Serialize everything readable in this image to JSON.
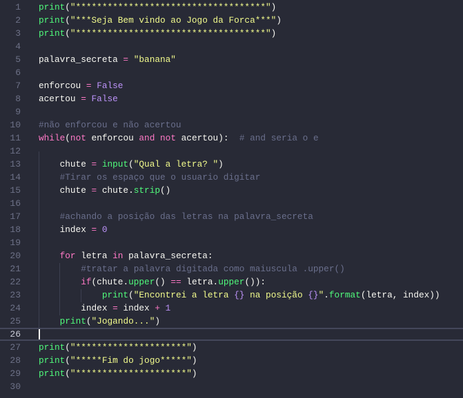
{
  "theme": {
    "background": "#282a36",
    "function": "#50fa7b",
    "string": "#f1fa8c",
    "keyword": "#ff79c6",
    "constant": "#bd93f9",
    "comment": "#6a6f8c"
  },
  "editor": {
    "current_line": 26,
    "lines": [
      {
        "n": "1",
        "tokens": [
          [
            "fn",
            "print"
          ],
          [
            "id",
            "("
          ],
          [
            "str",
            "\"************************************\""
          ],
          [
            "id",
            ")"
          ]
        ]
      },
      {
        "n": "2",
        "tokens": [
          [
            "fn",
            "print"
          ],
          [
            "id",
            "("
          ],
          [
            "str",
            "\"***Seja Bem vindo ao Jogo da Forca***\""
          ],
          [
            "id",
            ")"
          ]
        ]
      },
      {
        "n": "3",
        "tokens": [
          [
            "fn",
            "print"
          ],
          [
            "id",
            "("
          ],
          [
            "str",
            "\"************************************\""
          ],
          [
            "id",
            ")"
          ]
        ]
      },
      {
        "n": "4",
        "tokens": []
      },
      {
        "n": "5",
        "tokens": [
          [
            "id",
            "palavra_secreta "
          ],
          [
            "op",
            "="
          ],
          [
            "id",
            " "
          ],
          [
            "str",
            "\"banana\""
          ]
        ]
      },
      {
        "n": "6",
        "tokens": []
      },
      {
        "n": "7",
        "tokens": [
          [
            "id",
            "enforcou "
          ],
          [
            "op",
            "="
          ],
          [
            "id",
            " "
          ],
          [
            "const",
            "False"
          ]
        ]
      },
      {
        "n": "8",
        "tokens": [
          [
            "id",
            "acertou "
          ],
          [
            "op",
            "="
          ],
          [
            "id",
            " "
          ],
          [
            "const",
            "False"
          ]
        ]
      },
      {
        "n": "9",
        "tokens": []
      },
      {
        "n": "10",
        "tokens": [
          [
            "cm",
            "#não enforcou e não acertou"
          ]
        ]
      },
      {
        "n": "11",
        "tokens": [
          [
            "kw",
            "while"
          ],
          [
            "id",
            "("
          ],
          [
            "kw",
            "not"
          ],
          [
            "id",
            " enforcou "
          ],
          [
            "kw",
            "and"
          ],
          [
            "id",
            " "
          ],
          [
            "kw",
            "not"
          ],
          [
            "id",
            " acertou):  "
          ],
          [
            "cm",
            "# and seria o e"
          ]
        ]
      },
      {
        "n": "12",
        "tokens": []
      },
      {
        "n": "13",
        "tokens": [
          [
            "id",
            "    chute "
          ],
          [
            "op",
            "="
          ],
          [
            "id",
            " "
          ],
          [
            "fn",
            "input"
          ],
          [
            "id",
            "("
          ],
          [
            "str",
            "\"Qual a letra? \""
          ],
          [
            "id",
            ")"
          ]
        ]
      },
      {
        "n": "14",
        "tokens": [
          [
            "id",
            "    "
          ],
          [
            "cm",
            "#Tirar os espaço que o usuario digitar"
          ]
        ]
      },
      {
        "n": "15",
        "tokens": [
          [
            "id",
            "    chute "
          ],
          [
            "op",
            "="
          ],
          [
            "id",
            " chute."
          ],
          [
            "fn",
            "strip"
          ],
          [
            "id",
            "()"
          ]
        ]
      },
      {
        "n": "16",
        "tokens": []
      },
      {
        "n": "17",
        "tokens": [
          [
            "id",
            "    "
          ],
          [
            "cm",
            "#achando a posição das letras na palavra_secreta"
          ]
        ]
      },
      {
        "n": "18",
        "tokens": [
          [
            "id",
            "    index "
          ],
          [
            "op",
            "="
          ],
          [
            "id",
            " "
          ],
          [
            "num",
            "0"
          ]
        ]
      },
      {
        "n": "19",
        "tokens": []
      },
      {
        "n": "20",
        "tokens": [
          [
            "id",
            "    "
          ],
          [
            "kw",
            "for"
          ],
          [
            "id",
            " letra "
          ],
          [
            "kw",
            "in"
          ],
          [
            "id",
            " palavra_secreta:"
          ]
        ]
      },
      {
        "n": "21",
        "tokens": [
          [
            "id",
            "        "
          ],
          [
            "cm",
            "#tratar a palavra digitada como maiuscula .upper()"
          ]
        ]
      },
      {
        "n": "22",
        "tokens": [
          [
            "id",
            "        "
          ],
          [
            "kw",
            "if"
          ],
          [
            "id",
            "(chute."
          ],
          [
            "fn",
            "upper"
          ],
          [
            "id",
            "() "
          ],
          [
            "op",
            "=="
          ],
          [
            "id",
            " letra."
          ],
          [
            "fn",
            "upper"
          ],
          [
            "id",
            "()):"
          ]
        ]
      },
      {
        "n": "23",
        "tokens": [
          [
            "id",
            "            "
          ],
          [
            "fn",
            "print"
          ],
          [
            "id",
            "("
          ],
          [
            "str",
            "\"Encontrei a letra "
          ],
          [
            "fmt",
            "{}"
          ],
          [
            "str",
            " na posição "
          ],
          [
            "fmt",
            "{}"
          ],
          [
            "str",
            "\""
          ],
          [
            "id",
            "."
          ],
          [
            "fn",
            "format"
          ],
          [
            "id",
            "(letra, index))"
          ]
        ]
      },
      {
        "n": "24",
        "tokens": [
          [
            "id",
            "        index "
          ],
          [
            "op",
            "="
          ],
          [
            "id",
            " index "
          ],
          [
            "op",
            "+"
          ],
          [
            "id",
            " "
          ],
          [
            "num",
            "1"
          ]
        ]
      },
      {
        "n": "25",
        "tokens": [
          [
            "id",
            "    "
          ],
          [
            "fn",
            "print"
          ],
          [
            "id",
            "("
          ],
          [
            "str",
            "\"Jogando...\""
          ],
          [
            "id",
            ")"
          ]
        ]
      },
      {
        "n": "26",
        "tokens": []
      },
      {
        "n": "27",
        "tokens": [
          [
            "fn",
            "print"
          ],
          [
            "id",
            "("
          ],
          [
            "str",
            "\"*********************\""
          ],
          [
            "id",
            ")"
          ]
        ]
      },
      {
        "n": "28",
        "tokens": [
          [
            "fn",
            "print"
          ],
          [
            "id",
            "("
          ],
          [
            "str",
            "\"*****Fim do jogo*****\""
          ],
          [
            "id",
            ")"
          ]
        ]
      },
      {
        "n": "29",
        "tokens": [
          [
            "fn",
            "print"
          ],
          [
            "id",
            "("
          ],
          [
            "str",
            "\"*********************\""
          ],
          [
            "id",
            ")"
          ]
        ]
      },
      {
        "n": "30",
        "tokens": []
      }
    ]
  }
}
